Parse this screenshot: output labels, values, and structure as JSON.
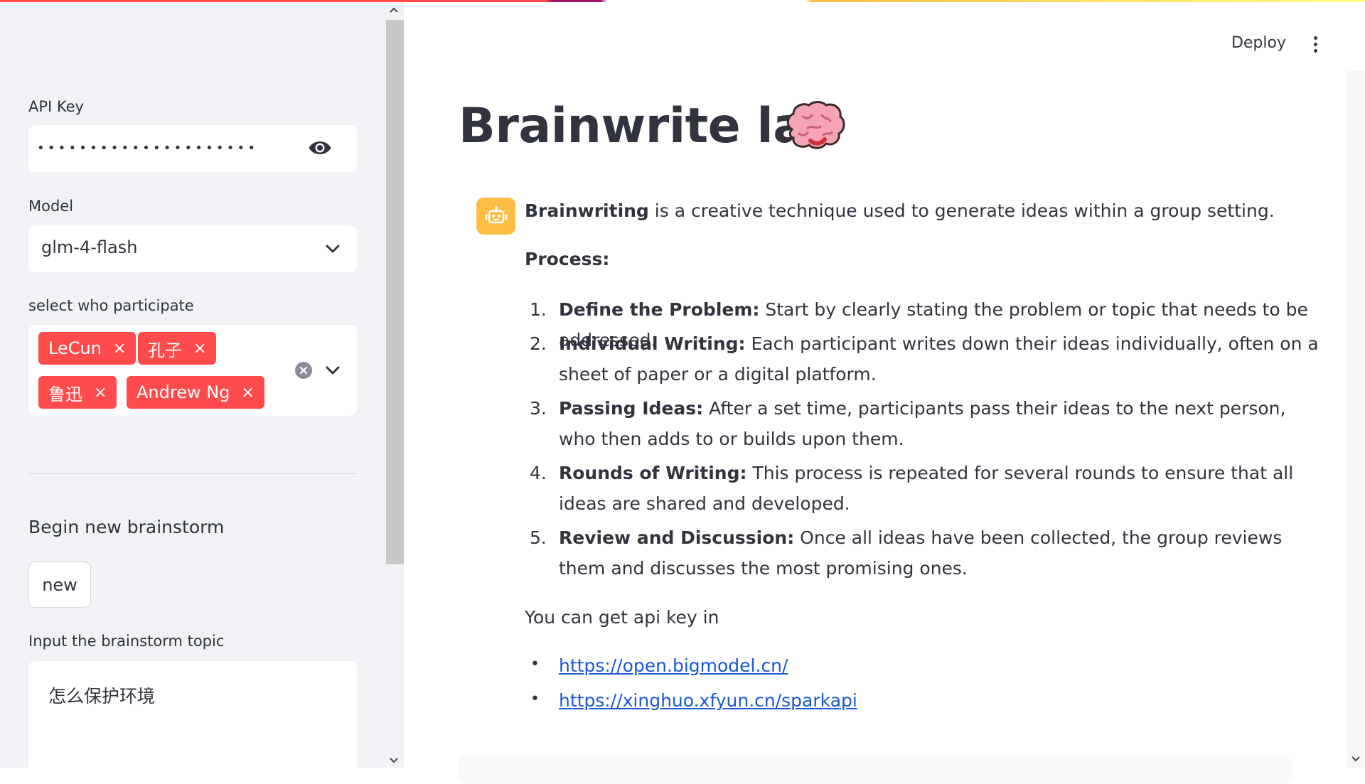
{
  "sidebar": {
    "api_key_label": "API Key",
    "api_key_masked": "•••••••••••••••••••••",
    "model_label": "Model",
    "model_value": "glm-4-flash",
    "participants_label": "select who participate",
    "participants": [
      "LeCun",
      "孔子",
      "鲁迅",
      "Andrew Ng"
    ],
    "tag_remove_glyph": "×",
    "begin_label": "Begin new brainstorm",
    "new_button": "new",
    "topic_label": "Input the brainstorm topic",
    "topic_value": "怎么保护环境"
  },
  "header": {
    "deploy": "Deploy"
  },
  "main": {
    "title": "Brainwrite lab",
    "intro_bold": "Brainwriting",
    "intro_rest": " is a creative technique used to generate ideas within a group setting.",
    "process_heading": "Process:",
    "steps": [
      {
        "num": "1.",
        "title": "Define the Problem:",
        "text": " Start by clearly stating the problem or topic that needs to be addressed."
      },
      {
        "num": "2.",
        "title": "Individual Writing:",
        "text": " Each participant writes down their ideas individually, often on a sheet of paper or a digital platform."
      },
      {
        "num": "3.",
        "title": "Passing Ideas:",
        "text": " After a set time, participants pass their ideas to the next person, who then adds to or builds upon them."
      },
      {
        "num": "4.",
        "title": "Rounds of Writing:",
        "text": " This process is repeated for several rounds to ensure that all ideas are shared and developed."
      },
      {
        "num": "5.",
        "title": "Review and Discussion:",
        "text": " Once all ideas have been collected, the group reviews them and discusses the most promising ones."
      }
    ],
    "api_key_hint": "You can get api key in",
    "links": [
      "https://open.bigmodel.cn/",
      "https://xinghuo.xfyun.cn/sparkapi"
    ],
    "bullet_glyph": "•"
  },
  "colors": {
    "accent": "#ff4b4b",
    "avatar_bg": "#ffbd45",
    "link": "#1a58d1",
    "sidebar_bg": "#f0f2f6"
  }
}
